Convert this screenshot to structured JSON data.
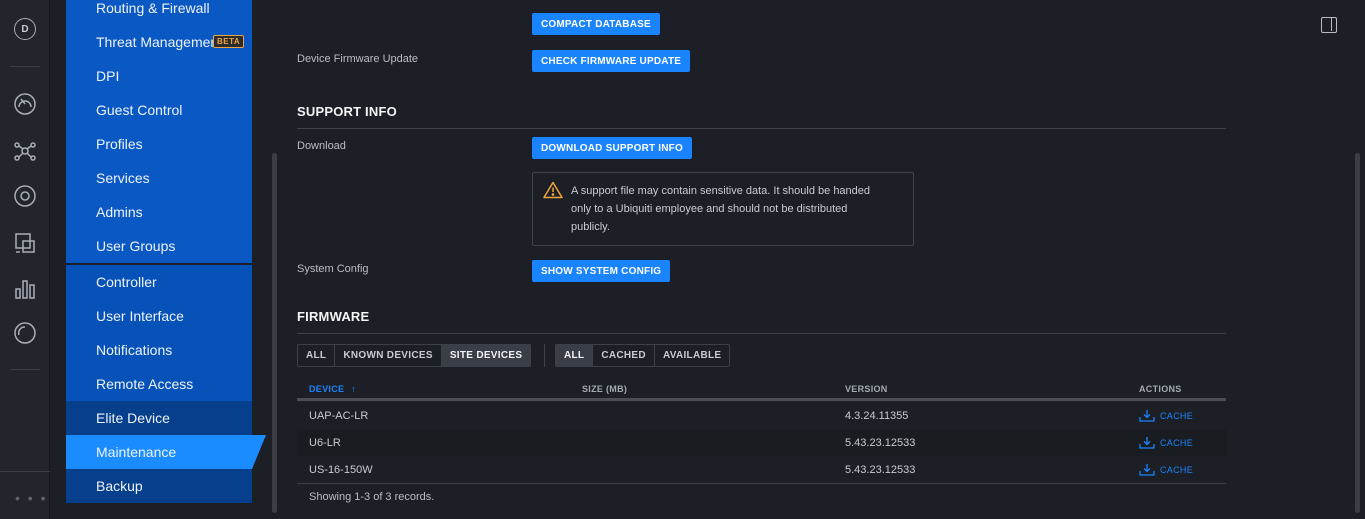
{
  "rail": {
    "avatar_letter": "D",
    "icons": [
      "dashboard-icon",
      "topology-icon",
      "target-icon",
      "devices-icon",
      "statistics-icon",
      "insights-icon"
    ],
    "more": "• • •"
  },
  "nav": {
    "top_items": [
      {
        "label": "Routing & Firewall"
      },
      {
        "label": "Threat Management"
      },
      {
        "label": "DPI"
      },
      {
        "label": "Guest Control"
      },
      {
        "label": "Profiles"
      },
      {
        "label": "Services"
      },
      {
        "label": "Admins"
      },
      {
        "label": "User Groups"
      }
    ],
    "beta_badge": "BETA",
    "bottom_items": [
      {
        "label": "Controller"
      },
      {
        "label": "User Interface"
      },
      {
        "label": "Notifications"
      },
      {
        "label": "Remote Access"
      },
      {
        "label": "Elite Device"
      },
      {
        "label": "Maintenance"
      },
      {
        "label": "Backup"
      }
    ],
    "active": "Maintenance"
  },
  "maintenance": {
    "compact_db_button": "COMPACT DATABASE",
    "firmware_update_label": "Device Firmware Update",
    "check_firmware_button": "CHECK FIRMWARE UPDATE"
  },
  "support": {
    "title": "SUPPORT INFO",
    "download_label": "Download",
    "download_button": "DOWNLOAD SUPPORT INFO",
    "warning_line1": "A support file may contain sensitive data. It should be handed",
    "warning_line2": "only to a Ubiquiti employee and should not be distributed",
    "warning_line3": "publicly.",
    "system_config_label": "System Config",
    "system_config_button": "SHOW SYSTEM CONFIG"
  },
  "firmware": {
    "title": "FIRMWARE",
    "device_filter": [
      "ALL",
      "KNOWN DEVICES",
      "SITE DEVICES"
    ],
    "device_filter_selected": "SITE DEVICES",
    "cache_filter": [
      "ALL",
      "CACHED",
      "AVAILABLE"
    ],
    "cache_filter_selected": "ALL",
    "columns": {
      "device": "DEVICE",
      "sort_arrow": "↑",
      "size": "SIZE (MB)",
      "version": "VERSION",
      "actions": "ACTIONS"
    },
    "rows": [
      {
        "device": "UAP-AC-LR",
        "size": "",
        "version": "4.3.24.11355",
        "action": "CACHE"
      },
      {
        "device": "U6-LR",
        "size": "",
        "version": "5.43.23.12533",
        "action": "CACHE"
      },
      {
        "device": "US-16-150W",
        "size": "",
        "version": "5.43.23.12533",
        "action": "CACHE"
      }
    ],
    "records": "Showing 1-3 of 3 records."
  },
  "colors": {
    "accent": "#1a84ff",
    "nav_blue": "#0a58c4",
    "nav_active": "#1a8cff",
    "beta": "#f0a43c",
    "warning": "#f0a43c"
  }
}
